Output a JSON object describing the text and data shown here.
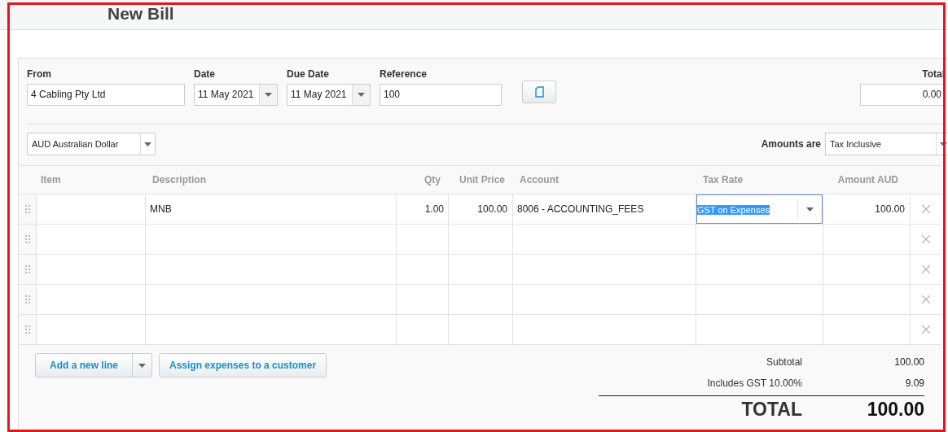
{
  "page": {
    "title": "New Bill"
  },
  "form": {
    "fields": [
      {
        "label": "From",
        "value": "4 Cabling Pty Ltd",
        "kind": "text"
      },
      {
        "label": "Date",
        "value": "11 May 2021",
        "kind": "date"
      },
      {
        "label": "Due Date",
        "value": "11 May 2021",
        "kind": "date"
      },
      {
        "label": "Reference",
        "value": "100",
        "kind": "text"
      }
    ],
    "total": {
      "label": "Total",
      "value": "0.00"
    }
  },
  "currency": {
    "value": "AUD Australian Dollar"
  },
  "amounts_are": {
    "label": "Amounts are",
    "value": "Tax Inclusive"
  },
  "table": {
    "columns": [
      "Item",
      "Description",
      "Qty",
      "Unit Price",
      "Account",
      "Tax Rate",
      "Amount AUD"
    ],
    "rows": [
      {
        "description": "MNB",
        "qty": "1.00",
        "unit_price": "100.00",
        "account": "8006 - ACCOUNTING_FEES",
        "tax_rate": "GST on Expenses",
        "tax_rate_selected": true,
        "amount": "100.00"
      },
      {},
      {},
      {},
      {}
    ]
  },
  "actions": {
    "add_line": "Add a new line",
    "assign": "Assign expenses to a customer"
  },
  "totals": {
    "lines": [
      {
        "label": "Subtotal",
        "value": "100.00"
      },
      {
        "label": "Includes GST 10.00%",
        "value": "9.09"
      }
    ],
    "total": {
      "label": "TOTAL",
      "value": "100.00"
    }
  }
}
